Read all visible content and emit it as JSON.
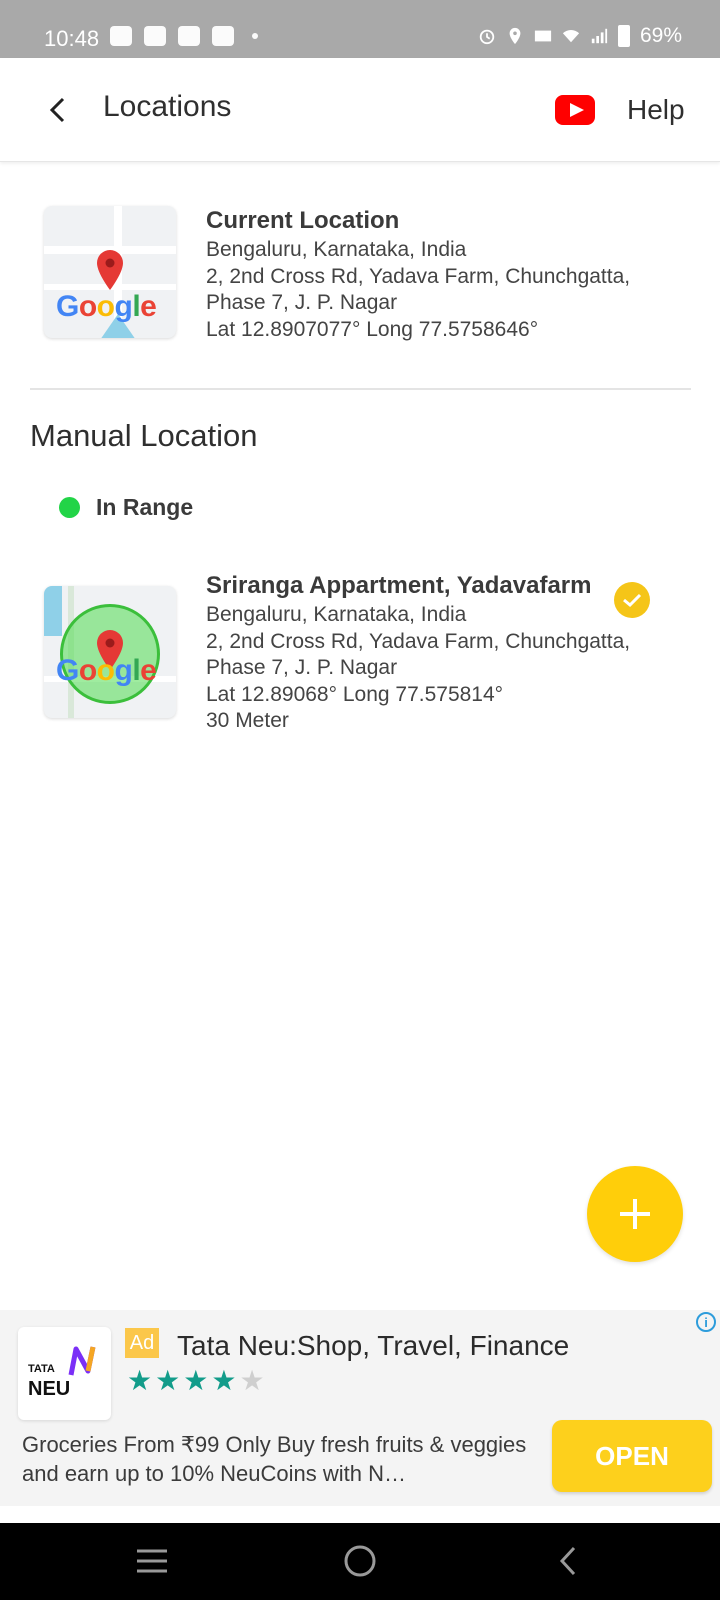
{
  "status_bar": {
    "time": "10:48",
    "battery": "69%"
  },
  "app_bar": {
    "title": "Locations",
    "help_label": "Help"
  },
  "current_location": {
    "name": "Current Location",
    "city": "Bengaluru, Karnataka, India",
    "address_line1": "2, 2nd Cross Rd, Yadava Farm, Chunchgatta,",
    "address_line2": "Phase 7, J. P. Nagar",
    "coords": "Lat 12.8907077° Long 77.5758646°",
    "map_logo": "Google"
  },
  "manual_section": {
    "title": "Manual Location",
    "status": "In Range"
  },
  "manual_location": {
    "name": "Sriranga Appartment, Yadavafarm",
    "city": "Bengaluru, Karnataka, India",
    "address_line1": "2, 2nd Cross Rd, Yadava Farm, Chunchgatta,",
    "address_line2": "Phase 7, J. P. Nagar",
    "coords": "Lat 12.89068° Long 77.575814°",
    "radius": "30 Meter",
    "map_logo": "Google"
  },
  "ad": {
    "badge": "Ad",
    "brand_top": "TATA",
    "brand_bottom": "NEU",
    "title": "Tata Neu:Shop, Travel, Finance",
    "rating": 4,
    "description": "Groceries From ₹99 Only Buy fresh fruits & veggies and earn up to 10% NeuCoins with N…",
    "cta": "OPEN",
    "info": "i"
  },
  "colors": {
    "accent": "#ffce0a",
    "in_range": "#22d447",
    "star": "#129c8a"
  }
}
